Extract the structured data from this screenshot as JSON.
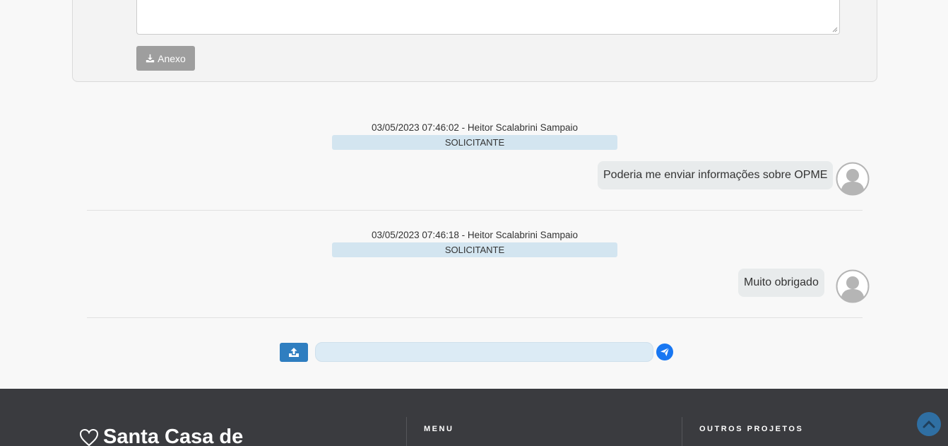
{
  "attachment_panel": {
    "attach_label": "Anexo"
  },
  "messages": [
    {
      "meta": "03/05/2023 07:46:02 - Heitor Scalabrini Sampaio",
      "role": "SOLICITANTE",
      "text": "Poderia me enviar informações sobre OPME"
    },
    {
      "meta": "03/05/2023 07:46:18 - Heitor Scalabrini Sampaio",
      "role": "SOLICITANTE",
      "text": "Muito obrigado"
    }
  ],
  "composer": {
    "value": "",
    "placeholder": ""
  },
  "footer": {
    "brand": "Santa Casa de",
    "menu_heading": "MENU",
    "projects_heading": "OUTROS PROJETOS"
  },
  "colors": {
    "footer_bg": "#3a3b3f",
    "role_badge": "#d3e5f0",
    "upload_button": "#2f7ec0",
    "send_button": "#1877f2",
    "attach_button": "#9e9e9e"
  }
}
